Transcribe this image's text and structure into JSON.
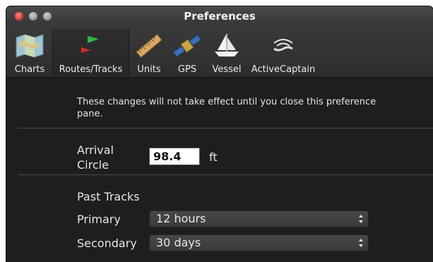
{
  "window": {
    "title": "Preferences"
  },
  "toolbar": {
    "items": [
      {
        "label": "Charts",
        "icon": "chart-map-icon"
      },
      {
        "label": "Routes/Tracks",
        "icon": "route-flags-icon",
        "selected": true
      },
      {
        "label": "Units",
        "icon": "ruler-icon"
      },
      {
        "label": "GPS",
        "icon": "satellite-icon"
      },
      {
        "label": "Vessel",
        "icon": "sailboat-icon"
      },
      {
        "label": "ActiveCaptain",
        "icon": "wireless-icon"
      }
    ]
  },
  "notice": "These changes will not take effect until you close this preference pane.",
  "arrival": {
    "label_line1": "Arrival",
    "label_line2": "Circle",
    "value": "98.4",
    "unit": "ft"
  },
  "tracks": {
    "heading": "Past Tracks",
    "primary_label": "Primary",
    "primary_value": "12 hours",
    "secondary_label": "Secondary",
    "secondary_value": "30 days"
  }
}
